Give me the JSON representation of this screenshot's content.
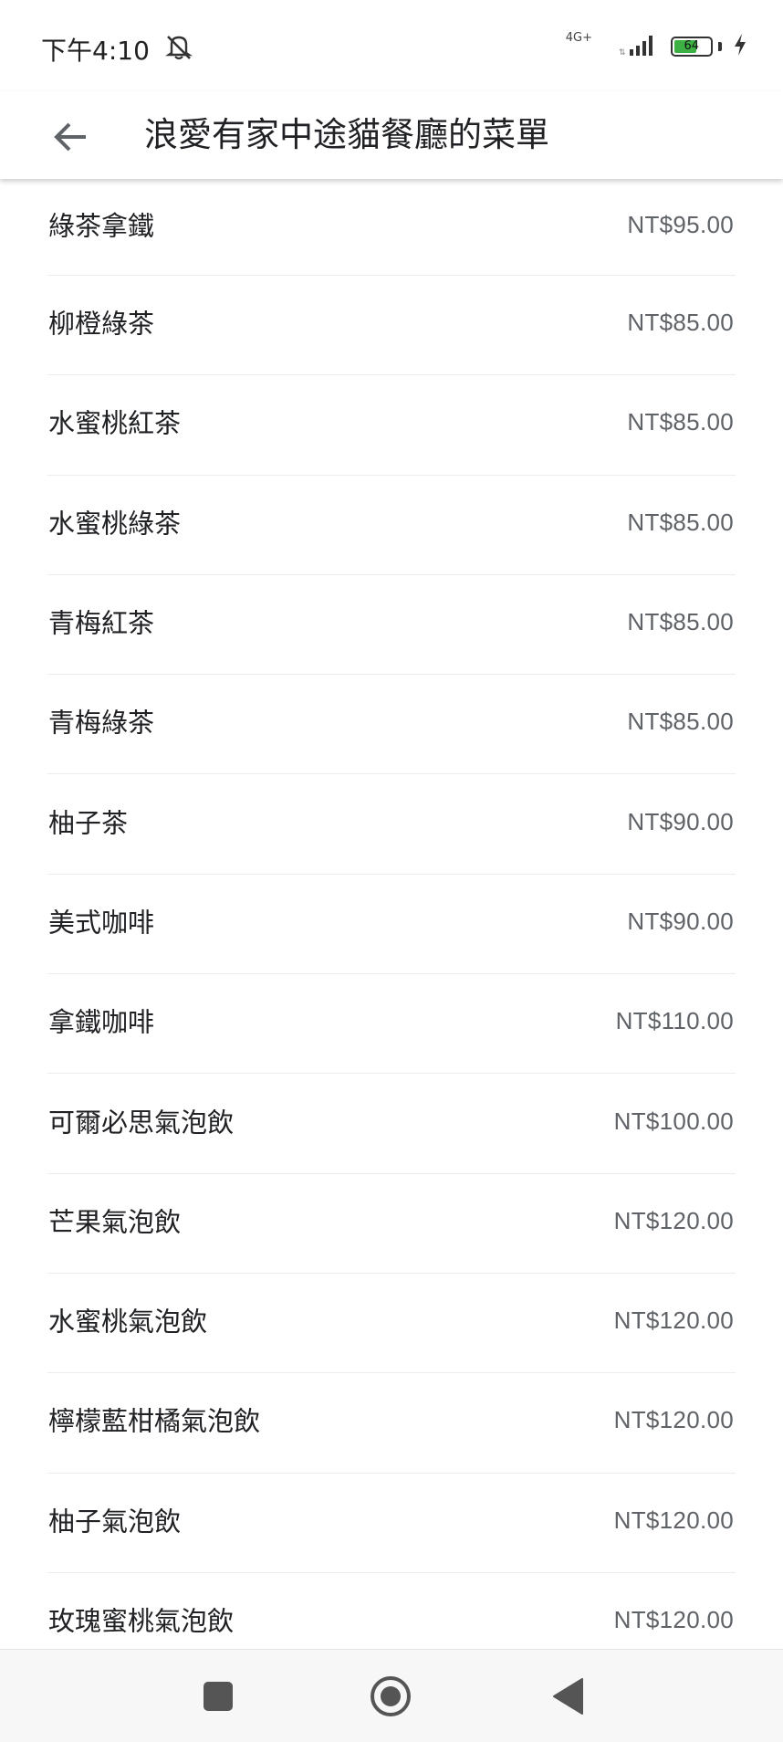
{
  "status_bar": {
    "time": "下午4:10",
    "network": "4G+",
    "battery_level": "64",
    "battery_fraction": 0.64,
    "icons": [
      "mute-notifications-icon",
      "signal-icon",
      "battery-icon",
      "charging-icon"
    ]
  },
  "app_bar": {
    "title": "浪愛有家中途貓餐廳的菜單",
    "back_icon": "arrow-left-icon"
  },
  "menu": {
    "items": [
      {
        "name": "綠茶拿鐵",
        "price": "NT$95.00"
      },
      {
        "name": "柳橙綠茶",
        "price": "NT$85.00"
      },
      {
        "name": "水蜜桃紅茶",
        "price": "NT$85.00"
      },
      {
        "name": "水蜜桃綠茶",
        "price": "NT$85.00"
      },
      {
        "name": "青梅紅茶",
        "price": "NT$85.00"
      },
      {
        "name": "青梅綠茶",
        "price": "NT$85.00"
      },
      {
        "name": "柚子茶",
        "price": "NT$90.00"
      },
      {
        "name": "美式咖啡",
        "price": "NT$90.00"
      },
      {
        "name": "拿鐵咖啡",
        "price": "NT$110.00"
      },
      {
        "name": "可爾必思氣泡飲",
        "price": "NT$100.00"
      },
      {
        "name": "芒果氣泡飲",
        "price": "NT$120.00"
      },
      {
        "name": "水蜜桃氣泡飲",
        "price": "NT$120.00"
      },
      {
        "name": "檸檬藍柑橘氣泡飲",
        "price": "NT$120.00"
      },
      {
        "name": "柚子氣泡飲",
        "price": "NT$120.00"
      },
      {
        "name": "玫瑰蜜桃氣泡飲",
        "price": "NT$120.00"
      }
    ]
  },
  "nav_bar": {
    "buttons": [
      "recents-square-icon",
      "home-circle-icon",
      "back-triangle-icon"
    ]
  },
  "colors": {
    "text_primary": "#202124",
    "text_price": "#5f6368",
    "divider": "#ececec",
    "battery_green": "#3cb043"
  }
}
